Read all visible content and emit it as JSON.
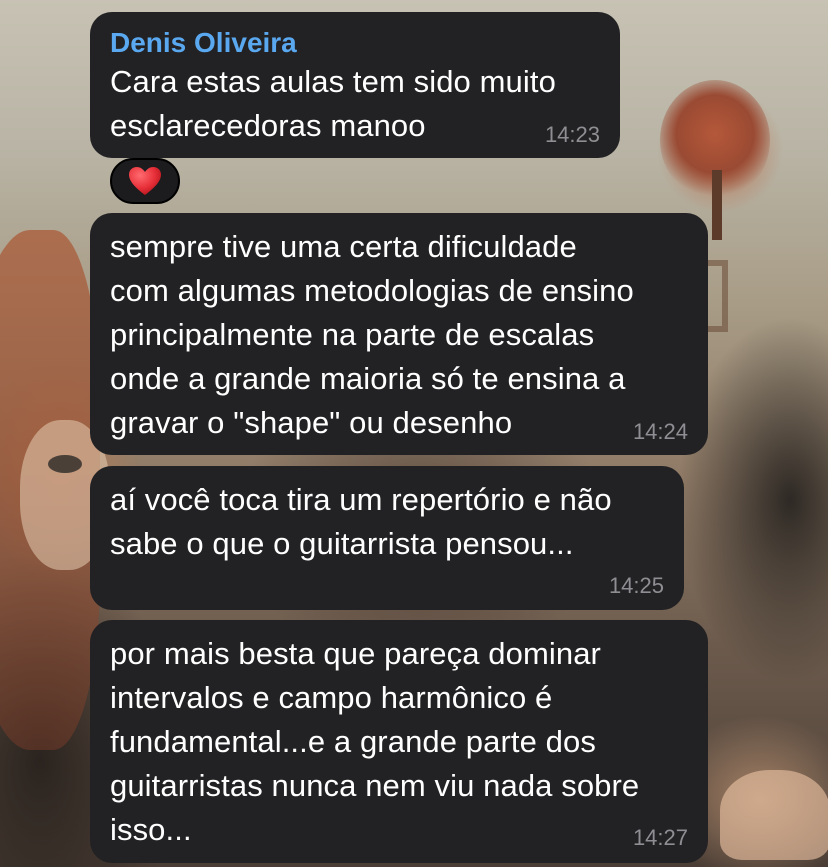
{
  "messages": [
    {
      "sender": "Denis Oliveira",
      "text": "Cara estas aulas tem sido muito\nesclarecedoras manoo",
      "time": "14:23",
      "reaction": "heart-emoji"
    },
    {
      "text": "sempre tive uma certa dificuldade\ncom algumas metodologias de ensino\nprincipalmente na parte de escalas\nonde a grande maioria só te ensina a\ngravar o \"shape\" ou desenho",
      "time": "14:24"
    },
    {
      "text": "aí você toca tira um repertório e não\nsabe o que o guitarrista pensou...",
      "time": "14:25"
    },
    {
      "text": "por mais besta que pareça dominar\nintervalos e campo harmônico é\nfundamental...e a grande parte dos\nguitarristas nunca nem viu nada sobre\nisso...",
      "time": "14:27"
    }
  ],
  "colors": {
    "bubble": "#222224",
    "sender_name": "#5aa8f0",
    "timestamp": "#8e8e93",
    "reaction_heart": "#e8313a"
  }
}
